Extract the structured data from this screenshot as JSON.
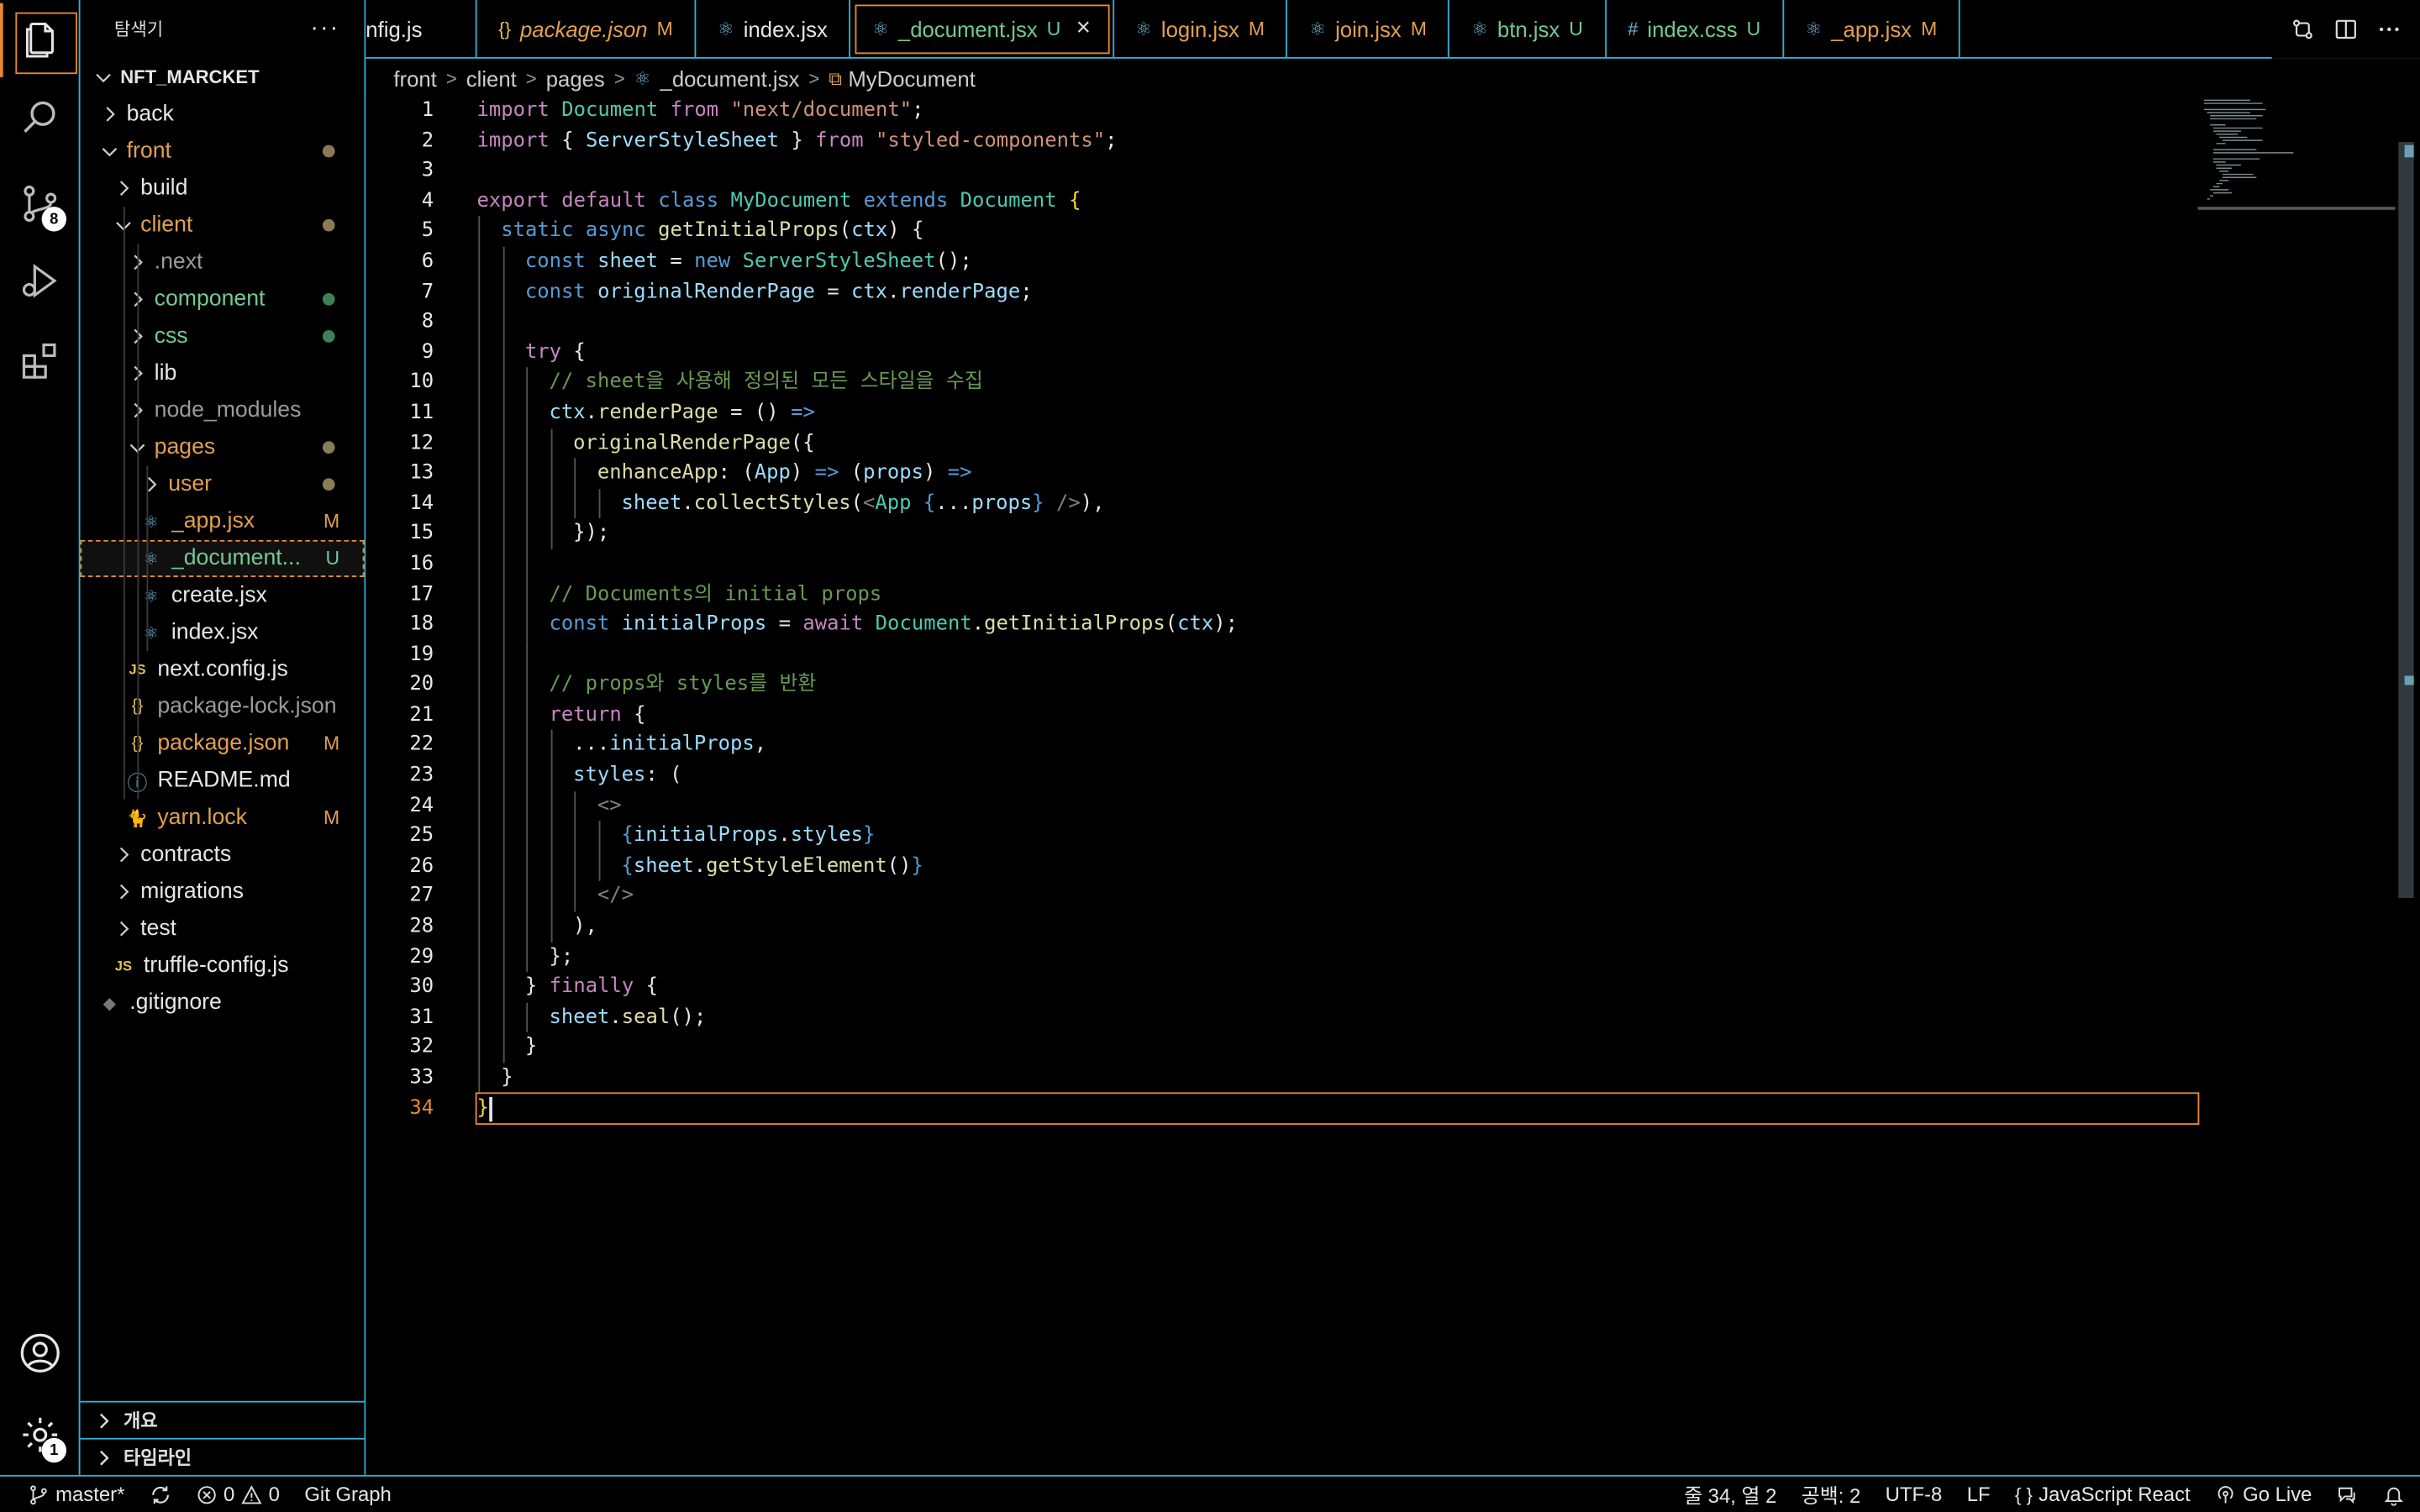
{
  "sidebar": {
    "title": "탐색기",
    "more": "···",
    "rows": [
      {
        "label": "NFT_MARCKET",
        "type": "root",
        "indent": 0,
        "color": "#e6e6e6",
        "bold": true
      },
      {
        "label": "back",
        "type": "folder",
        "open": false,
        "indent": 1,
        "color": "#e6e6e6"
      },
      {
        "label": "front",
        "type": "folder",
        "open": true,
        "indent": 1,
        "color": "#e0a050",
        "dot": true
      },
      {
        "label": "build",
        "type": "folder",
        "open": false,
        "indent": 2,
        "color": "#e6e6e6"
      },
      {
        "label": "client",
        "type": "folder",
        "open": true,
        "indent": 2,
        "color": "#e0a050",
        "dot": true
      },
      {
        "label": ".next",
        "type": "folder",
        "open": false,
        "indent": 3,
        "color": "#9a9a9a"
      },
      {
        "label": "component",
        "type": "folder",
        "open": false,
        "indent": 3,
        "color": "#73c991",
        "dot": true,
        "dotColor": "#73c991"
      },
      {
        "label": "css",
        "type": "folder",
        "open": false,
        "indent": 3,
        "color": "#73c991",
        "dot": true,
        "dotColor": "#73c991"
      },
      {
        "label": "lib",
        "type": "folder",
        "open": false,
        "indent": 3,
        "color": "#e6e6e6"
      },
      {
        "label": "node_modules",
        "type": "folder",
        "open": false,
        "indent": 3,
        "color": "#9a9a9a"
      },
      {
        "label": "pages",
        "type": "folder",
        "open": true,
        "indent": 3,
        "color": "#e0a050",
        "dot": true
      },
      {
        "label": "user",
        "type": "folder",
        "open": false,
        "indent": 4,
        "color": "#e0a050",
        "dot": true
      },
      {
        "label": "_app.jsx",
        "type": "file",
        "icon": "react",
        "indent": 4,
        "color": "#e0a050",
        "status": "M",
        "statusColor": "#e0a050"
      },
      {
        "label": "_document...",
        "type": "file",
        "icon": "react",
        "indent": 4,
        "color": "#73c991",
        "status": "U",
        "statusColor": "#73c991",
        "selected": true
      },
      {
        "label": "create.jsx",
        "type": "file",
        "icon": "react",
        "indent": 4,
        "color": "#e6e6e6"
      },
      {
        "label": "index.jsx",
        "type": "file",
        "icon": "react",
        "indent": 4,
        "color": "#e6e6e6"
      },
      {
        "label": "next.config.js",
        "type": "file",
        "icon": "js",
        "indent": 3,
        "color": "#e6e6e6"
      },
      {
        "label": "package-lock.json",
        "type": "file",
        "icon": "json",
        "indent": 3,
        "color": "#9a9a9a"
      },
      {
        "label": "package.json",
        "type": "file",
        "icon": "json",
        "indent": 3,
        "color": "#e0a050",
        "status": "M",
        "statusColor": "#e0a050"
      },
      {
        "label": "README.md",
        "type": "file",
        "icon": "info",
        "indent": 3,
        "color": "#e6e6e6"
      },
      {
        "label": "yarn.lock",
        "type": "file",
        "icon": "yarn",
        "indent": 3,
        "color": "#e0a050",
        "status": "M",
        "statusColor": "#e0a050"
      },
      {
        "label": "contracts",
        "type": "folder",
        "open": false,
        "indent": 2,
        "color": "#e6e6e6"
      },
      {
        "label": "migrations",
        "type": "folder",
        "open": false,
        "indent": 2,
        "color": "#e6e6e6"
      },
      {
        "label": "test",
        "type": "folder",
        "open": false,
        "indent": 2,
        "color": "#e6e6e6"
      },
      {
        "label": "truffle-config.js",
        "type": "file",
        "icon": "js",
        "indent": 2,
        "color": "#e6e6e6"
      },
      {
        "label": ".gitignore",
        "type": "file",
        "icon": "git",
        "indent": 1,
        "color": "#e6e6e6"
      }
    ],
    "panels": [
      {
        "label": "개요"
      },
      {
        "label": "타임라인"
      }
    ]
  },
  "activity": {
    "items": [
      {
        "name": "explorer-icon",
        "active": true
      },
      {
        "name": "search-icon"
      },
      {
        "name": "source-control-icon",
        "badge": "8"
      },
      {
        "name": "run-debug-icon"
      },
      {
        "name": "extensions-icon"
      }
    ],
    "bottom": [
      {
        "name": "account-icon"
      },
      {
        "name": "settings-gear-icon",
        "badge": "1"
      }
    ]
  },
  "tabs": [
    {
      "label": "nfig.js",
      "icon": "",
      "color": "#e6e6e6"
    },
    {
      "label": "package.json",
      "icon": "{}",
      "iconColor": "#e6c04c",
      "color": "#e0a050",
      "status": "M",
      "italic": true
    },
    {
      "label": "index.jsx",
      "icon": "react",
      "color": "#e6e6e6"
    },
    {
      "label": "_document.jsx",
      "icon": "react",
      "color": "#73c991",
      "status": "U",
      "active": true
    },
    {
      "label": "login.jsx",
      "icon": "react",
      "color": "#e0a050",
      "status": "M"
    },
    {
      "label": "join.jsx",
      "icon": "react",
      "color": "#e0a050",
      "status": "M"
    },
    {
      "label": "btn.jsx",
      "icon": "react",
      "color": "#73c991",
      "status": "U"
    },
    {
      "label": "index.css",
      "icon": "#",
      "iconColor": "#6fb3d2",
      "color": "#73c991",
      "status": "U"
    },
    {
      "label": "_app.jsx",
      "icon": "react",
      "color": "#e0a050",
      "status": "M"
    }
  ],
  "breadcrumb": {
    "parts": [
      "front",
      "client",
      "pages"
    ],
    "file": "_document.jsx",
    "symbol": "MyDocument"
  },
  "editor": {
    "current_line": 34,
    "lines": [
      {
        "n": 1,
        "i": 0,
        "t": [
          [
            "kw",
            "import"
          ],
          [
            "pl",
            " "
          ],
          [
            "cls",
            "Document"
          ],
          [
            "pl",
            " "
          ],
          [
            "kw",
            "from"
          ],
          [
            "pl",
            " "
          ],
          [
            "str",
            "\"next/document\""
          ],
          [
            "pl",
            ";"
          ]
        ]
      },
      {
        "n": 2,
        "i": 0,
        "t": [
          [
            "kw",
            "import"
          ],
          [
            "pl",
            " { "
          ],
          [
            "var",
            "ServerStyleSheet"
          ],
          [
            "pl",
            " } "
          ],
          [
            "kw",
            "from"
          ],
          [
            "pl",
            " "
          ],
          [
            "str",
            "\"styled-components\""
          ],
          [
            "pl",
            ";"
          ]
        ]
      },
      {
        "n": 3,
        "i": 0,
        "t": []
      },
      {
        "n": 4,
        "i": 0,
        "t": [
          [
            "kw",
            "export"
          ],
          [
            "pl",
            " "
          ],
          [
            "kw",
            "default"
          ],
          [
            "pl",
            " "
          ],
          [
            "decl",
            "class"
          ],
          [
            "pl",
            " "
          ],
          [
            "cls",
            "MyDocument"
          ],
          [
            "pl",
            " "
          ],
          [
            "decl",
            "extends"
          ],
          [
            "pl",
            " "
          ],
          [
            "cls",
            "Document"
          ],
          [
            "pl",
            " "
          ],
          [
            "br",
            "{"
          ]
        ]
      },
      {
        "n": 5,
        "i": 1,
        "t": [
          [
            "decl",
            "static"
          ],
          [
            "pl",
            " "
          ],
          [
            "decl",
            "async"
          ],
          [
            "pl",
            " "
          ],
          [
            "fn",
            "getInitialProps"
          ],
          [
            "pl",
            "("
          ],
          [
            "var",
            "ctx"
          ],
          [
            "pl",
            ") {"
          ]
        ]
      },
      {
        "n": 6,
        "i": 2,
        "t": [
          [
            "decl",
            "const"
          ],
          [
            "pl",
            " "
          ],
          [
            "var",
            "sheet"
          ],
          [
            "pl",
            " = "
          ],
          [
            "decl",
            "new"
          ],
          [
            "pl",
            " "
          ],
          [
            "cls",
            "ServerStyleSheet"
          ],
          [
            "pl",
            "();"
          ]
        ]
      },
      {
        "n": 7,
        "i": 2,
        "t": [
          [
            "decl",
            "const"
          ],
          [
            "pl",
            " "
          ],
          [
            "var",
            "originalRenderPage"
          ],
          [
            "pl",
            " = "
          ],
          [
            "var",
            "ctx"
          ],
          [
            "pl",
            "."
          ],
          [
            "var",
            "renderPage"
          ],
          [
            "pl",
            ";"
          ]
        ]
      },
      {
        "n": 8,
        "i": 2,
        "t": []
      },
      {
        "n": 9,
        "i": 2,
        "t": [
          [
            "kw",
            "try"
          ],
          [
            "pl",
            " {"
          ]
        ]
      },
      {
        "n": 10,
        "i": 3,
        "t": [
          [
            "cm",
            "// sheet을 사용해 정의된 모든 스타일을 수집"
          ]
        ]
      },
      {
        "n": 11,
        "i": 3,
        "t": [
          [
            "var",
            "ctx"
          ],
          [
            "pl",
            "."
          ],
          [
            "fn",
            "renderPage"
          ],
          [
            "pl",
            " = () "
          ],
          [
            "decl",
            "=>"
          ]
        ]
      },
      {
        "n": 12,
        "i": 4,
        "t": [
          [
            "fn",
            "originalRenderPage"
          ],
          [
            "pl",
            "({"
          ]
        ]
      },
      {
        "n": 13,
        "i": 5,
        "t": [
          [
            "fn",
            "enhanceApp"
          ],
          [
            "pl",
            ": ("
          ],
          [
            "var",
            "App"
          ],
          [
            "pl",
            ") "
          ],
          [
            "decl",
            "=>"
          ],
          [
            "pl",
            " ("
          ],
          [
            "var",
            "props"
          ],
          [
            "pl",
            ") "
          ],
          [
            "decl",
            "=>"
          ]
        ]
      },
      {
        "n": 14,
        "i": 6,
        "t": [
          [
            "var",
            "sheet"
          ],
          [
            "pl",
            "."
          ],
          [
            "fn",
            "collectStyles"
          ],
          [
            "pl",
            "("
          ],
          [
            "tag",
            "<"
          ],
          [
            "cls",
            "App"
          ],
          [
            "pl",
            " "
          ],
          [
            "decl",
            "{"
          ],
          [
            "pl",
            "..."
          ],
          [
            "var",
            "props"
          ],
          [
            "decl",
            "}"
          ],
          [
            "pl",
            " "
          ],
          [
            "tag",
            "/>"
          ],
          [
            "pl",
            "),"
          ]
        ]
      },
      {
        "n": 15,
        "i": 4,
        "t": [
          [
            "pl",
            "});"
          ]
        ]
      },
      {
        "n": 16,
        "i": 3,
        "t": []
      },
      {
        "n": 17,
        "i": 3,
        "t": [
          [
            "cm",
            "// Documents의 initial props"
          ]
        ]
      },
      {
        "n": 18,
        "i": 3,
        "t": [
          [
            "decl",
            "const"
          ],
          [
            "pl",
            " "
          ],
          [
            "var",
            "initialProps"
          ],
          [
            "pl",
            " = "
          ],
          [
            "kw",
            "await"
          ],
          [
            "pl",
            " "
          ],
          [
            "cls",
            "Document"
          ],
          [
            "pl",
            "."
          ],
          [
            "fn",
            "getInitialProps"
          ],
          [
            "pl",
            "("
          ],
          [
            "var",
            "ctx"
          ],
          [
            "pl",
            ");"
          ]
        ]
      },
      {
        "n": 19,
        "i": 3,
        "t": []
      },
      {
        "n": 20,
        "i": 3,
        "t": [
          [
            "cm",
            "// props와 styles를 반환"
          ]
        ]
      },
      {
        "n": 21,
        "i": 3,
        "t": [
          [
            "kw",
            "return"
          ],
          [
            "pl",
            " {"
          ]
        ]
      },
      {
        "n": 22,
        "i": 4,
        "t": [
          [
            "pl",
            "..."
          ],
          [
            "var",
            "initialProps"
          ],
          [
            "pl",
            ","
          ]
        ]
      },
      {
        "n": 23,
        "i": 4,
        "t": [
          [
            "var",
            "styles"
          ],
          [
            "pl",
            ": ("
          ]
        ]
      },
      {
        "n": 24,
        "i": 5,
        "t": [
          [
            "tag",
            "<>"
          ]
        ]
      },
      {
        "n": 25,
        "i": 6,
        "t": [
          [
            "decl",
            "{"
          ],
          [
            "var",
            "initialProps"
          ],
          [
            "pl",
            "."
          ],
          [
            "var",
            "styles"
          ],
          [
            "decl",
            "}"
          ]
        ]
      },
      {
        "n": 26,
        "i": 6,
        "t": [
          [
            "decl",
            "{"
          ],
          [
            "var",
            "sheet"
          ],
          [
            "pl",
            "."
          ],
          [
            "fn",
            "getStyleElement"
          ],
          [
            "pl",
            "()"
          ],
          [
            "decl",
            "}"
          ]
        ]
      },
      {
        "n": 27,
        "i": 5,
        "t": [
          [
            "tag",
            "</>"
          ]
        ]
      },
      {
        "n": 28,
        "i": 4,
        "t": [
          [
            "pl",
            "),"
          ]
        ]
      },
      {
        "n": 29,
        "i": 3,
        "t": [
          [
            "pl",
            "};"
          ]
        ]
      },
      {
        "n": 30,
        "i": 2,
        "t": [
          [
            "pl",
            "} "
          ],
          [
            "kw",
            "finally"
          ],
          [
            "pl",
            " {"
          ]
        ]
      },
      {
        "n": 31,
        "i": 3,
        "t": [
          [
            "var",
            "sheet"
          ],
          [
            "pl",
            "."
          ],
          [
            "fn",
            "seal"
          ],
          [
            "pl",
            "();"
          ]
        ]
      },
      {
        "n": 32,
        "i": 2,
        "t": [
          [
            "pl",
            "}"
          ]
        ]
      },
      {
        "n": 33,
        "i": 1,
        "t": [
          [
            "pl",
            "}"
          ]
        ]
      },
      {
        "n": 34,
        "i": 0,
        "t": [
          [
            "br",
            "}"
          ]
        ]
      }
    ]
  },
  "status": {
    "branch": "master*",
    "errors": "0",
    "warnings": "0",
    "git_graph": "Git Graph",
    "position": "줄 34, 열 2",
    "spaces": "공백: 2",
    "encoding": "UTF-8",
    "eol": "LF",
    "language": "JavaScript React",
    "golive": "Go Live"
  },
  "colors": {
    "accent": "#e98a2b",
    "border": "#31b2d4",
    "modified": "#e0a050",
    "untracked": "#73c991"
  }
}
